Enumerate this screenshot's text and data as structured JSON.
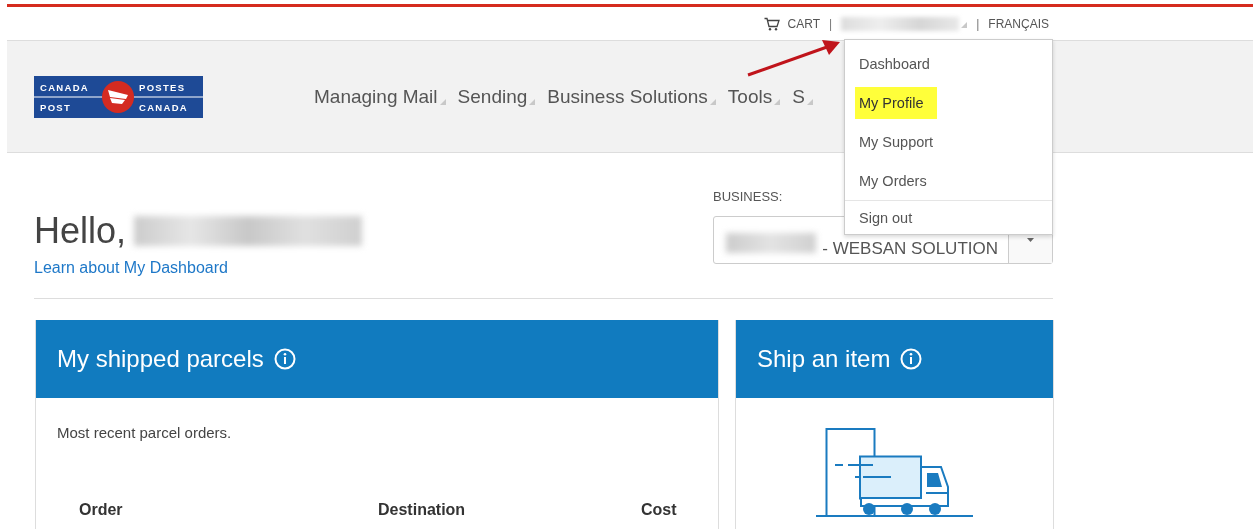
{
  "top_bar": {
    "cart": "CART",
    "separator_1": "|",
    "separator_2": "|",
    "language": "FRANÇAIS"
  },
  "logo": {
    "words": [
      "CANADA",
      "POST",
      "POSTES",
      "CANADA"
    ]
  },
  "nav": {
    "items": [
      {
        "label": "Managing Mail"
      },
      {
        "label": "Sending"
      },
      {
        "label": "Business Solutions"
      },
      {
        "label": "Tools"
      },
      {
        "label": "S"
      }
    ]
  },
  "account_menu": {
    "expanded": true,
    "items": [
      {
        "label": "Dashboard",
        "highlighted": false,
        "separated": false
      },
      {
        "label": "My Profile",
        "highlighted": true,
        "separated": false
      },
      {
        "label": "My Support",
        "highlighted": false,
        "separated": false
      },
      {
        "label": "My Orders",
        "highlighted": false,
        "separated": false
      },
      {
        "label": "Sign out",
        "highlighted": false,
        "separated": true
      }
    ]
  },
  "greeting": "Hello,",
  "dashboard_link": "Learn about My Dashboard",
  "business": {
    "label": "BUSINESS:",
    "value": "- WEBSAN SOLUTION"
  },
  "cards": [
    {
      "kind": "table",
      "title": "My shipped parcels",
      "description": "Most recent parcel orders.",
      "columns": [
        "Order",
        "Destination",
        "Cost"
      ]
    },
    {
      "kind": "illustration",
      "title": "Ship an item"
    }
  ]
}
